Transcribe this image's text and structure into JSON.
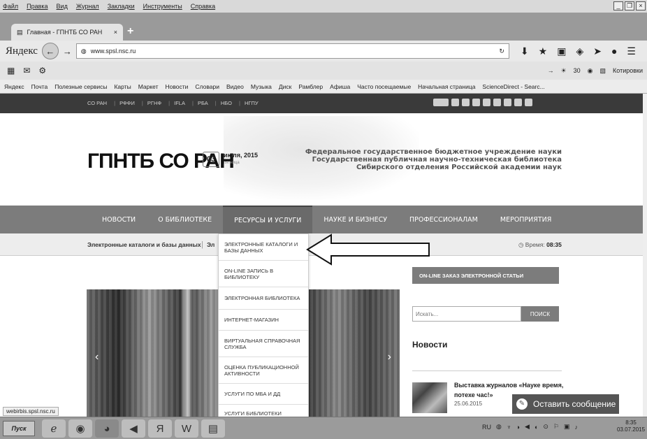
{
  "menu": [
    "Файл",
    "Правка",
    "Вид",
    "Журнал",
    "Закладки",
    "Инструменты",
    "Справка"
  ],
  "tab": {
    "title": "Главная - ГПНТБ СО РАН",
    "close": "×",
    "new": "+"
  },
  "nav": {
    "brand": "Яндекс",
    "url": "www.spsl.nsc.ru",
    "back": "←",
    "forward": "→"
  },
  "toolbar2": {
    "count": "30",
    "kotirovki": "Котировки"
  },
  "bookmarks": [
    "Яндекс",
    "Почта",
    "Полезные сервисы",
    "Карты",
    "Маркет",
    "Новости",
    "Словари",
    "Видео",
    "Музыка",
    "Диск",
    "Рамблер",
    "Афиша",
    "Часто посещаемые",
    "Начальная страница",
    "ScienceDirect - Searc..."
  ],
  "site": {
    "top_links": [
      "СО РАН",
      "РФФИ",
      "РГНФ",
      "IFLA",
      "РБА",
      "НБО",
      "НГПУ"
    ],
    "logo": "ГПНТБ СО РАН",
    "date": {
      "day": "03",
      "month": "июля, 2015",
      "weekday": "пятница"
    },
    "org": [
      "Федеральное государственное бюджетное учреждение науки",
      "Государственная публичная научно-техническая библиотека",
      "Сибирского отделения Российской академии наук"
    ],
    "main_nav": [
      "НОВОСТИ",
      "О БИБЛИОТЕКЕ",
      "РЕСУРСЫ И УСЛУГИ",
      "НАУКЕ И БИЗНЕСУ",
      "ПРОФЕССИОНАЛАМ",
      "МЕРОПРИЯТИЯ"
    ],
    "subnav": {
      "left": "Электронные каталоги и базы данных",
      "partial": "Эл",
      "time_label": "Время:",
      "time": "08:35"
    },
    "dropdown": [
      "ЭЛЕКТРОННЫЕ КАТАЛОГИ И БАЗЫ ДАННЫХ",
      "ON-LINE ЗАПИСЬ В БИБЛИОТЕКУ",
      "ЭЛЕКТРОННАЯ БИБЛИОТЕКА",
      "ИНТЕРНЕТ-МАГАЗИН",
      "ВИРТУАЛЬНАЯ СПРАВОЧНАЯ СЛУЖБА",
      "ОЦЕНКА ПУБЛИКАЦИОННОЙ АКТИВНОСТИ",
      "УСЛУГИ ПО МБА И ДД",
      "УСЛУГИ БИБЛИОТЕКИ"
    ],
    "order_button": "ON-LINE ЗАКАЗ ЭЛЕКТРОННОЙ СТАТЬИ",
    "search": {
      "placeholder": "Искать...",
      "button": "ПОИСК"
    },
    "news": {
      "heading": "Новости",
      "title": "Выставка журналов «Науке время, потехе час!»",
      "date": "25.06.2015"
    },
    "chat": "Оставить сообщение",
    "status_url": "webirbis.spsl.nsc.ru"
  },
  "taskbar": {
    "start": "Пуск",
    "lang": "RU",
    "time": "8:35",
    "date": "03.07.2015"
  },
  "colors": {
    "nav": "#7c7c7c",
    "topstrip": "#3a3a3a",
    "chrome": "#9a9a9a"
  }
}
